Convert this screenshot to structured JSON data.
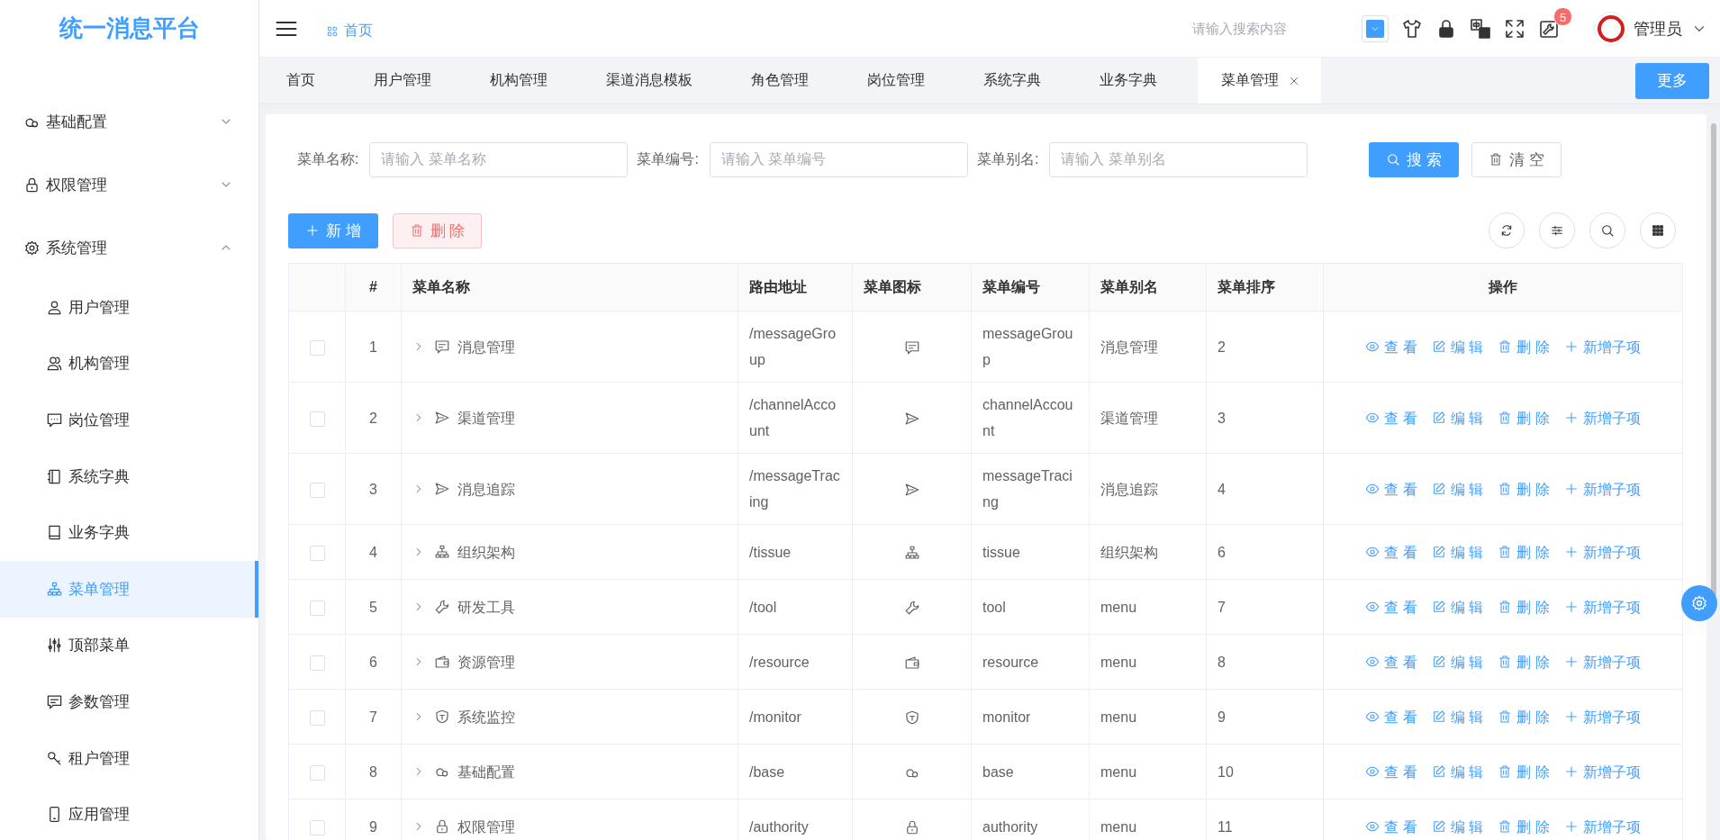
{
  "sidebar": {
    "logo": "统一消息平台",
    "items": [
      {
        "label": "基础配置",
        "selected": false,
        "expanded": false
      },
      {
        "label": "权限管理",
        "selected": false,
        "expanded": false
      },
      {
        "label": "系统管理",
        "selected": false,
        "expanded": true,
        "children": [
          {
            "label": "用户管理",
            "selected": false
          },
          {
            "label": "机构管理",
            "selected": false
          },
          {
            "label": "岗位管理",
            "selected": false
          },
          {
            "label": "系统字典",
            "selected": false
          },
          {
            "label": "业务字典",
            "selected": false
          },
          {
            "label": "菜单管理",
            "selected": true
          },
          {
            "label": "顶部菜单",
            "selected": false
          },
          {
            "label": "参数管理",
            "selected": false
          },
          {
            "label": "租户管理",
            "selected": false
          },
          {
            "label": "应用管理",
            "selected": false
          }
        ]
      }
    ]
  },
  "header": {
    "breadcrumb": "首页",
    "search": {
      "placeholder": "请输入搜索内容"
    },
    "badge": "5",
    "user": "管理员"
  },
  "tabs": [
    {
      "label": "首页",
      "selected": false
    },
    {
      "label": "用户管理",
      "selected": false
    },
    {
      "label": "机构管理",
      "selected": false
    },
    {
      "label": "渠道消息模板",
      "selected": false
    },
    {
      "label": "角色管理",
      "selected": false
    },
    {
      "label": "岗位管理",
      "selected": false
    },
    {
      "label": "系统字典",
      "selected": false
    },
    {
      "label": "业务字典",
      "selected": false
    },
    {
      "label": "菜单管理",
      "selected": true
    }
  ],
  "more_button": "更多",
  "filters": [
    {
      "label": "菜单名称:",
      "placeholder": "请输入 菜单名称"
    },
    {
      "label": "菜单编号:",
      "placeholder": "请输入 菜单编号"
    },
    {
      "label": "菜单别名:",
      "placeholder": "请输入 菜单别名"
    }
  ],
  "search_button": "搜 索",
  "clear_button": "清 空",
  "add_button": "新 增",
  "delete_button": "删 除",
  "table": {
    "columns": [
      "#",
      "菜单名称",
      "路由地址",
      "菜单图标",
      "菜单编号",
      "菜单别名",
      "菜单排序",
      "操作"
    ],
    "rows": [
      {
        "index": "1",
        "name": "消息管理",
        "route": "/messageGroup",
        "code": "messageGroup",
        "alias": "消息管理",
        "order": "2",
        "checked": false,
        "expanded": false,
        "actions": [
          {
            "kind": "view",
            "label": "查 看"
          },
          {
            "kind": "edit",
            "label": "编 辑"
          },
          {
            "kind": "delete",
            "label": "删 除"
          },
          {
            "kind": "add",
            "label": "新增子项"
          }
        ]
      },
      {
        "index": "2",
        "name": "渠道管理",
        "route": "/channelAccount",
        "code": "channelAccount",
        "alias": "渠道管理",
        "order": "3",
        "checked": false,
        "expanded": false,
        "actions": [
          {
            "kind": "view",
            "label": "查 看"
          },
          {
            "kind": "edit",
            "label": "编 辑"
          },
          {
            "kind": "delete",
            "label": "删 除"
          },
          {
            "kind": "add",
            "label": "新增子项"
          }
        ]
      },
      {
        "index": "3",
        "name": "消息追踪",
        "route": "/messageTracing",
        "code": "messageTracing",
        "alias": "消息追踪",
        "order": "4",
        "checked": false,
        "expanded": false,
        "actions": [
          {
            "kind": "view",
            "label": "查 看"
          },
          {
            "kind": "edit",
            "label": "编 辑"
          },
          {
            "kind": "delete",
            "label": "删 除"
          },
          {
            "kind": "add",
            "label": "新增子项"
          }
        ]
      },
      {
        "index": "4",
        "name": "组织架构",
        "route": "/tissue",
        "code": "tissue",
        "alias": "组织架构",
        "order": "6",
        "checked": false,
        "expanded": false,
        "actions": [
          {
            "kind": "view",
            "label": "查 看"
          },
          {
            "kind": "edit",
            "label": "编 辑"
          },
          {
            "kind": "delete",
            "label": "删 除"
          },
          {
            "kind": "add",
            "label": "新增子项"
          }
        ]
      },
      {
        "index": "5",
        "name": "研发工具",
        "route": "/tool",
        "code": "tool",
        "alias": "menu",
        "order": "7",
        "checked": false,
        "expanded": false,
        "actions": [
          {
            "kind": "view",
            "label": "查 看"
          },
          {
            "kind": "edit",
            "label": "编 辑"
          },
          {
            "kind": "delete",
            "label": "删 除"
          },
          {
            "kind": "add",
            "label": "新增子项"
          }
        ]
      },
      {
        "index": "6",
        "name": "资源管理",
        "route": "/resource",
        "code": "resource",
        "alias": "menu",
        "order": "8",
        "checked": false,
        "expanded": false,
        "actions": [
          {
            "kind": "view",
            "label": "查 看"
          },
          {
            "kind": "edit",
            "label": "编 辑"
          },
          {
            "kind": "delete",
            "label": "删 除"
          },
          {
            "kind": "add",
            "label": "新增子项"
          }
        ]
      },
      {
        "index": "7",
        "name": "系统监控",
        "route": "/monitor",
        "code": "monitor",
        "alias": "menu",
        "order": "9",
        "checked": false,
        "expanded": false,
        "actions": [
          {
            "kind": "view",
            "label": "查 看"
          },
          {
            "kind": "edit",
            "label": "编 辑"
          },
          {
            "kind": "delete",
            "label": "删 除"
          },
          {
            "kind": "add",
            "label": "新增子项"
          }
        ]
      },
      {
        "index": "8",
        "name": "基础配置",
        "route": "/base",
        "code": "base",
        "alias": "menu",
        "order": "10",
        "checked": false,
        "expanded": false,
        "actions": [
          {
            "kind": "view",
            "label": "查 看"
          },
          {
            "kind": "edit",
            "label": "编 辑"
          },
          {
            "kind": "delete",
            "label": "删 除"
          },
          {
            "kind": "add",
            "label": "新增子项"
          }
        ]
      },
      {
        "index": "9",
        "name": "权限管理",
        "route": "/authority",
        "code": "authority",
        "alias": "menu",
        "order": "11",
        "checked": false,
        "expanded": false,
        "actions": [
          {
            "kind": "view",
            "label": "查 看"
          },
          {
            "kind": "edit",
            "label": "编 辑"
          },
          {
            "kind": "delete",
            "label": "删 除"
          },
          {
            "kind": "add",
            "label": "新增子项"
          }
        ]
      }
    ]
  }
}
